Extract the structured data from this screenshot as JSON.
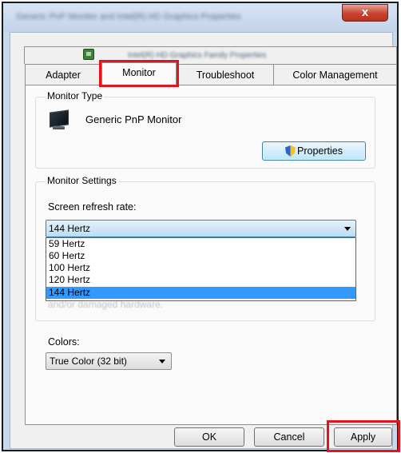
{
  "window": {
    "title": "Generic PnP Monitor and Intel(R) HD Graphics Properties",
    "close_glyph": "x"
  },
  "tabs": {
    "driver_tab_label": "Intel(R) HD Graphics Family Properties",
    "adapter": "Adapter",
    "monitor": "Monitor",
    "troubleshoot": "Troubleshoot",
    "color_management": "Color Management"
  },
  "monitor_type": {
    "title": "Monitor Type",
    "monitor_name": "Generic PnP Monitor",
    "properties_button": "Properties"
  },
  "monitor_settings": {
    "title": "Monitor Settings",
    "refresh_rate_label": "Screen refresh rate:",
    "refresh_rate_selected": "144 Hertz",
    "refresh_rate_options": [
      "59 Hertz",
      "60 Hertz",
      "100 Hertz",
      "120 Hertz",
      "144 Hertz"
    ],
    "warning_text": "and/or damaged hardware."
  },
  "colors": {
    "label": "Colors:",
    "selected": "True Color (32 bit)"
  },
  "buttons": {
    "ok": "OK",
    "cancel": "Cancel",
    "apply": "Apply"
  },
  "theme": {
    "highlight_color": "#e3141b",
    "selection_color": "#3399ff",
    "chrome_color": "#c9d9ec"
  }
}
